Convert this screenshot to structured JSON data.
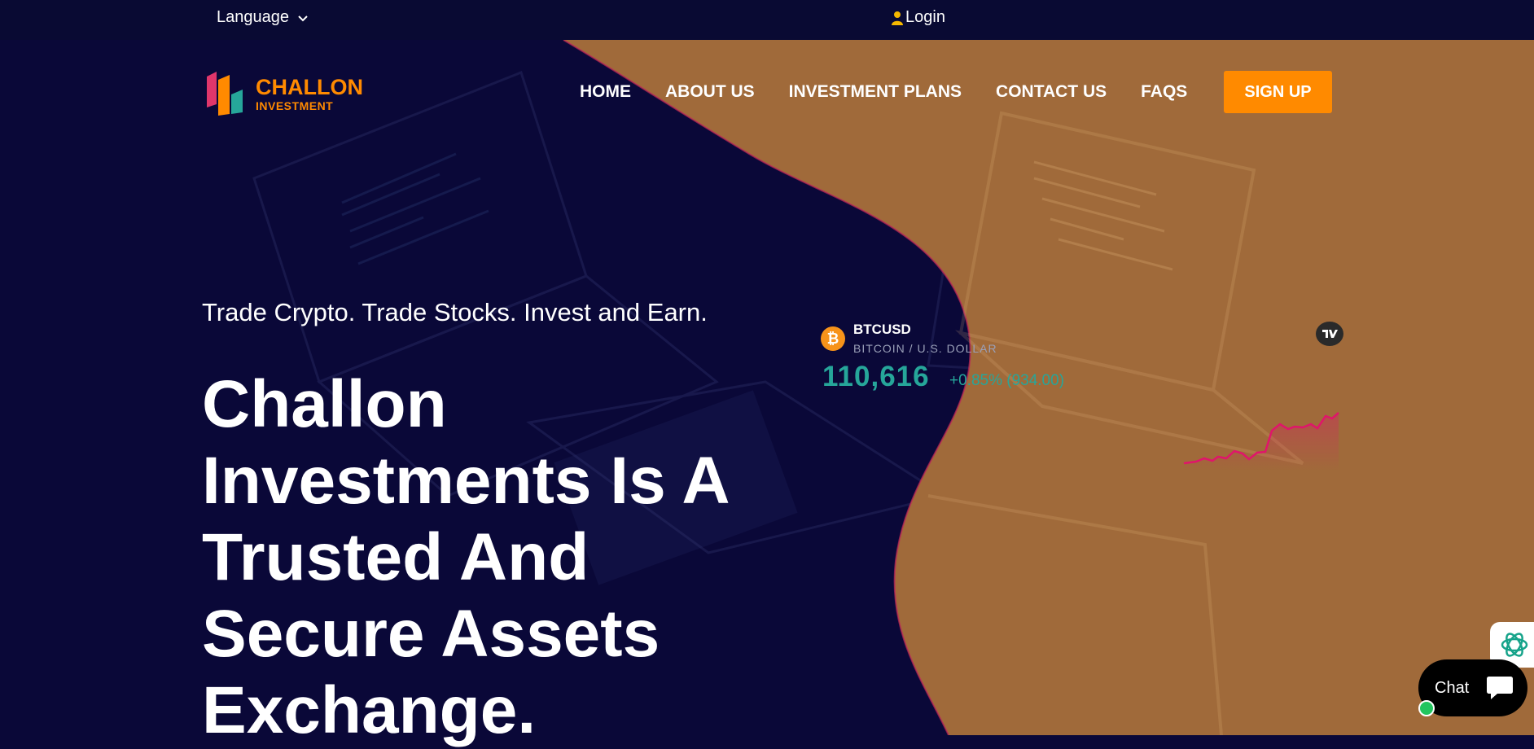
{
  "topbar": {
    "language_label": "Language",
    "login_label": "Login"
  },
  "brand": {
    "line1": "CHALLON",
    "line2": "INVESTMENT"
  },
  "nav": [
    {
      "label": "HOME"
    },
    {
      "label": "ABOUT US"
    },
    {
      "label": "INVESTMENT PLANS"
    },
    {
      "label": "CONTACT US"
    },
    {
      "label": "FAQS"
    }
  ],
  "signup_label": "SIGN UP",
  "hero": {
    "tagline": "Trade Crypto. Trade Stocks. Invest and Earn.",
    "headline": "Challon Investments Is A Trusted And Secure Assets Exchange."
  },
  "ticker": {
    "symbol": "BTCUSD",
    "pair": "BITCOIN / U.S. DOLLAR",
    "price": "110,616",
    "change": "+0.85% (934.00)",
    "coin_glyph": "₿"
  },
  "chat": {
    "label": "Chat"
  },
  "colors": {
    "navy": "#0a0838",
    "orange": "#ff8a00",
    "wave": "#a06a3a",
    "teal": "#26a69a",
    "sparkline": "#e0156b"
  },
  "icons": [
    "chevron-down-icon",
    "user-icon",
    "bitcoin-icon",
    "tradingview-icon",
    "chat-bubble-icon",
    "openai-icon"
  ]
}
